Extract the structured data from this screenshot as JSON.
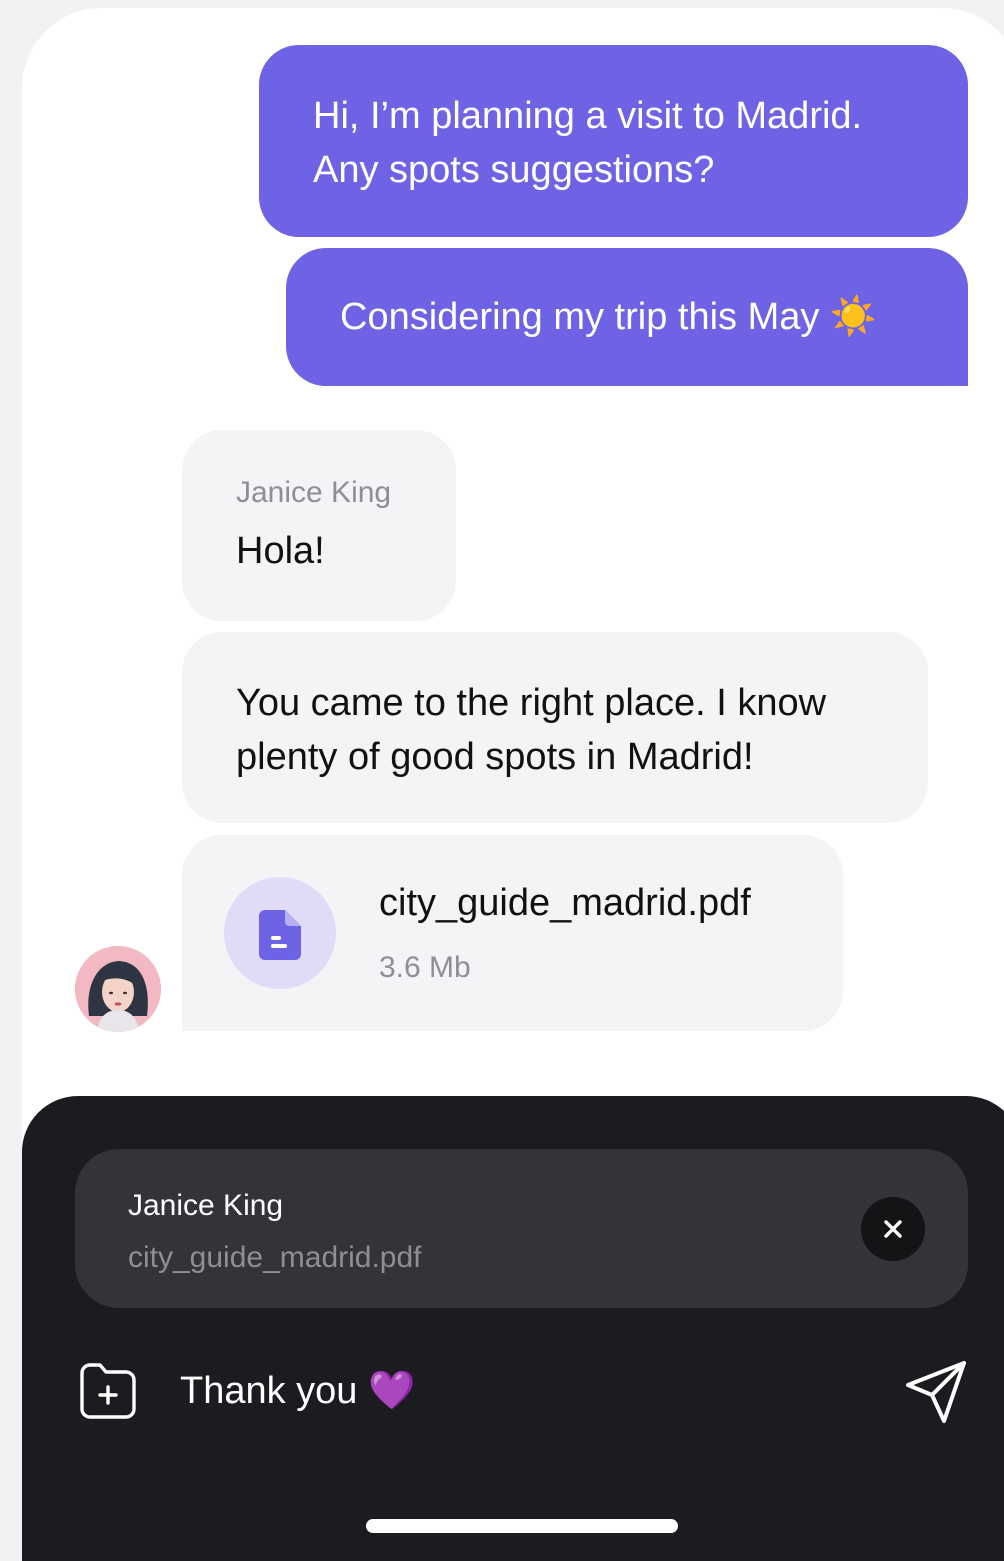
{
  "messages": {
    "outgoing_1": "Hi, I’m planning a visit to Madrid.\nAny spots suggestions?",
    "outgoing_2": "Considering my trip this May ☀️",
    "incoming_sender": "Janice King",
    "incoming_1": "Hola!",
    "incoming_2": "You came to the right place. I know\nplenty of good spots in Madrid!",
    "file": {
      "name": "city_guide_madrid.pdf",
      "size": "3.6 Mb",
      "icon": "document-icon"
    }
  },
  "composer": {
    "reply": {
      "sender": "Janice King",
      "file": "city_guide_madrid.pdf"
    },
    "input_value": "Thank you 💜",
    "attach_icon": "folder-plus-icon",
    "send_icon": "send-icon",
    "close_icon": "close-icon"
  },
  "colors": {
    "outgoing_bubble": "#6e62e5",
    "incoming_bubble": "#f4f4f6",
    "composer_bg": "#1c1c20",
    "reply_bg": "#333338"
  }
}
